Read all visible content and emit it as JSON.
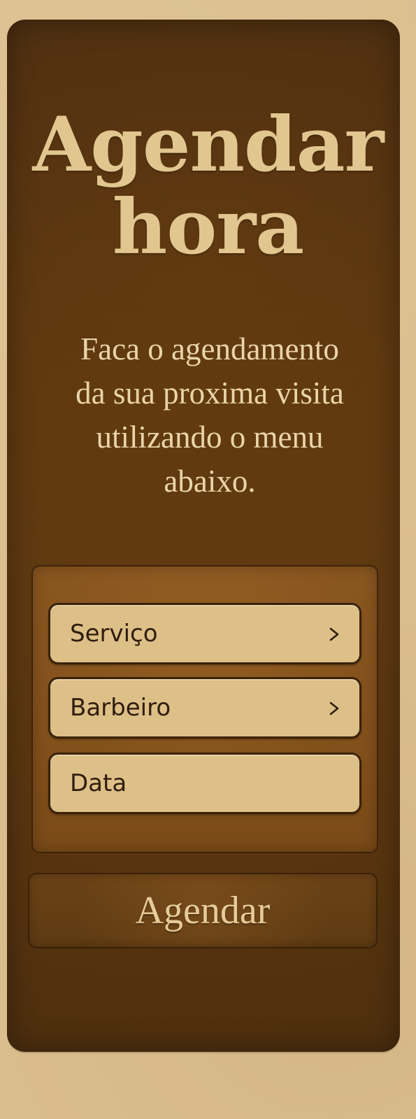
{
  "header": {
    "title_line1": "Agendar",
    "title_line2": "hora"
  },
  "intro": {
    "line1": "Faca o agendamento",
    "line2": "da sua proxima visita",
    "line3": "utilizando o menu",
    "line4": "abaixo."
  },
  "form": {
    "fields": [
      {
        "label": "Serviço",
        "icon": "chevron-right-icon"
      },
      {
        "label": "Barbeiro",
        "icon": "chevron-right-icon"
      },
      {
        "label": "Data"
      }
    ]
  },
  "actions": {
    "submit_label": "Agendar"
  },
  "colors": {
    "page_background": "#dcbf8f",
    "card_background": "#4a2d10",
    "panel_background": "#8a5620",
    "field_background": "#ddbf88",
    "title_text": "#e2c690",
    "field_text": "#2f1e0c"
  }
}
